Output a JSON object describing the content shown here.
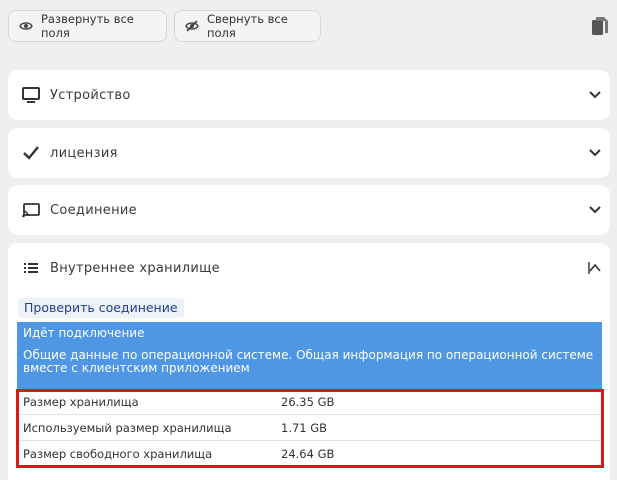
{
  "toolbar": {
    "expand_label": "Развернуть все поля",
    "collapse_label": "Свернуть все поля",
    "expand_icon": "eye-icon",
    "collapse_icon": "eye-slash-icon",
    "copy_icon": "copy-icon"
  },
  "panels": [
    {
      "title": "Устройство",
      "icon": "monitor-icon",
      "expanded": false
    },
    {
      "title": "лицензия",
      "icon": "checkmark-icon",
      "expanded": false
    },
    {
      "title": "Соединение",
      "icon": "cast-icon",
      "expanded": false
    },
    {
      "title": "Внутреннее хранилище",
      "icon": "storage-list-icon",
      "expanded": true
    }
  ],
  "storage": {
    "check_link": "Проверить соединение",
    "status": "Идёт подключение",
    "description": "Общие данные по операционной системе. Общая информация по операционной системе вместе с клиентским приложением",
    "rows": [
      {
        "label": "Размер хранилища",
        "value": "26.35 GB"
      },
      {
        "label": "Используемый размер хранилища",
        "value": "1.71 GB"
      },
      {
        "label": "Размер свободного хранилища",
        "value": "24.64 GB"
      }
    ]
  },
  "colors": {
    "info_bg": "#4f96e4",
    "highlight": "#e0141c",
    "link": "#1f3f8a"
  }
}
